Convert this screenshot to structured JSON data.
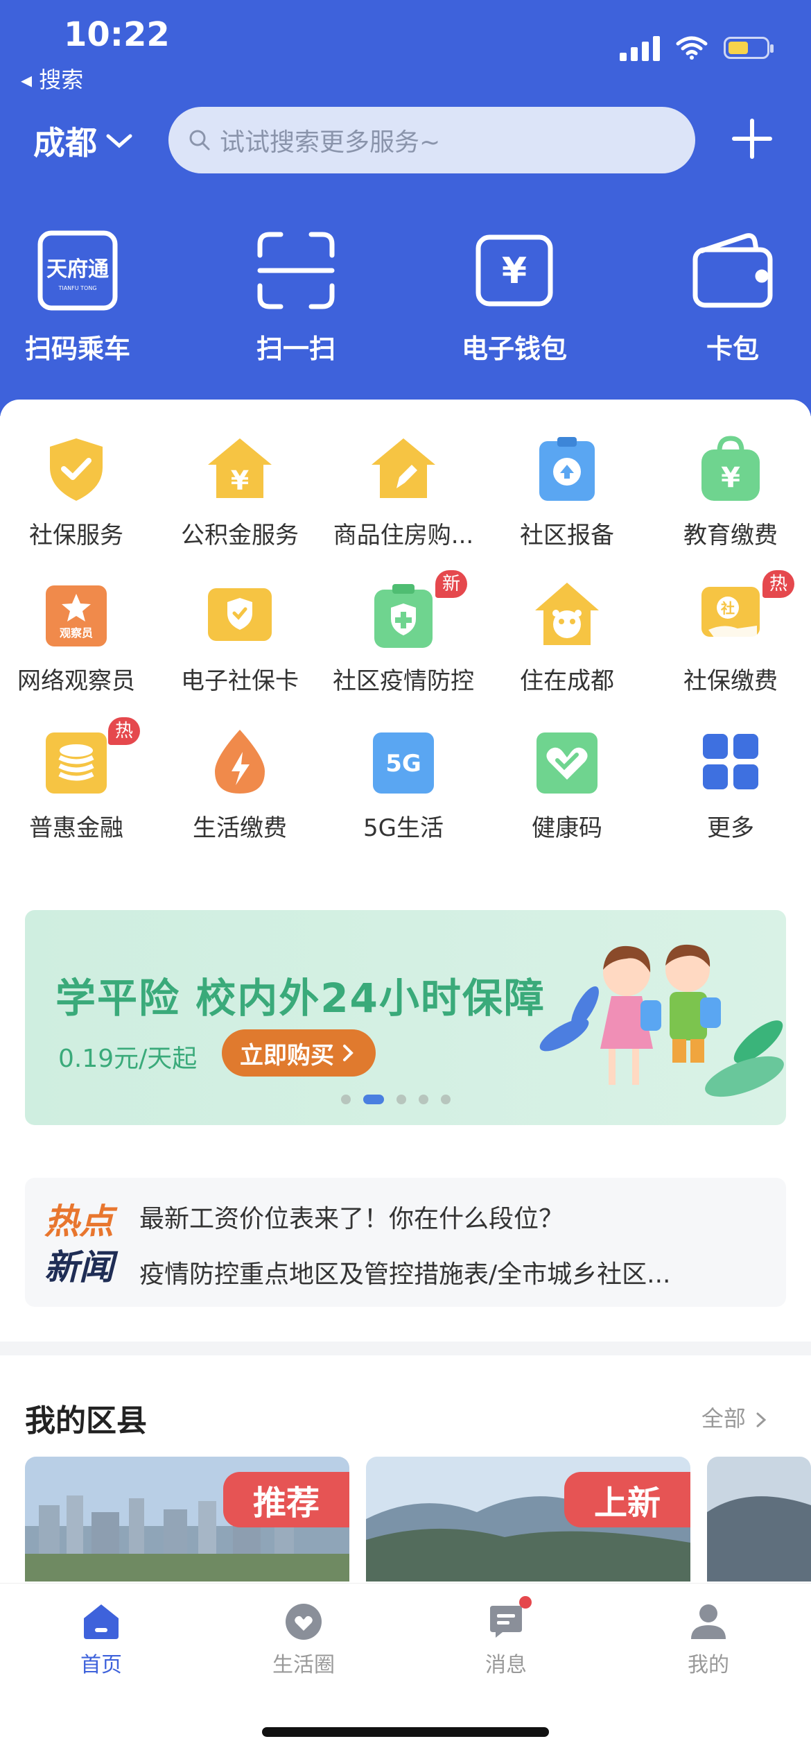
{
  "status_bar": {
    "time": "10:22",
    "back_label": "◂ 搜索"
  },
  "header": {
    "city": "成都",
    "search_placeholder": "试试搜索更多服务~"
  },
  "quick_actions": [
    {
      "label": "扫码乘车",
      "icon": "tianfutong-card-icon",
      "icon_text": "天府通",
      "icon_sub": "TIANFU TONG"
    },
    {
      "label": "扫一扫",
      "icon": "scan-icon"
    },
    {
      "label": "电子钱包",
      "icon": "yuan-wallet-icon",
      "icon_text": "¥"
    },
    {
      "label": "卡包",
      "icon": "card-wallet-icon"
    }
  ],
  "services": [
    {
      "label": "社保服务",
      "icon": "shield-check-icon"
    },
    {
      "label": "公积金服务",
      "icon": "house-yuan-icon",
      "icon_text": "¥"
    },
    {
      "label": "商品住房购...",
      "icon": "house-pen-icon"
    },
    {
      "label": "社区报备",
      "icon": "clipboard-upload-icon"
    },
    {
      "label": "教育缴费",
      "icon": "bag-yuan-icon",
      "icon_text": "¥"
    },
    {
      "label": "网络观察员",
      "icon": "observer-star-icon",
      "icon_text": "观察员"
    },
    {
      "label": "电子社保卡",
      "icon": "social-card-icon"
    },
    {
      "label": "社区疫情防控",
      "icon": "medical-kit-icon",
      "badge": "新"
    },
    {
      "label": "住在成都",
      "icon": "house-panda-icon"
    },
    {
      "label": "社保缴费",
      "icon": "hand-payment-icon",
      "icon_text": "社",
      "badge": "热"
    },
    {
      "label": "普惠金融",
      "icon": "coins-icon",
      "badge": "热"
    },
    {
      "label": "生活缴费",
      "icon": "lightning-drop-icon"
    },
    {
      "label": "5G生活",
      "icon": "5g-icon",
      "icon_text": "5G"
    },
    {
      "label": "健康码",
      "icon": "heart-check-icon"
    },
    {
      "label": "更多",
      "icon": "grid-more-icon"
    }
  ],
  "banner": {
    "title": "学平险 校内外24小时保障",
    "price": "0.19元/天起",
    "button": "立即购买",
    "dots": 5,
    "active_dot": 1
  },
  "news": {
    "tag_line1": "热点",
    "tag_line2": "新闻",
    "items": [
      "最新工资价位表来了！你在什么段位？",
      "疫情防控重点地区及管控措施表/全市城乡社区..."
    ]
  },
  "districts": {
    "title": "我的区县",
    "more": "全部",
    "cards": [
      {
        "badge": "推荐"
      },
      {
        "badge": "上新"
      },
      {
        "badge": ""
      }
    ]
  },
  "tabbar": [
    {
      "label": "首页",
      "icon": "home-icon",
      "active": true
    },
    {
      "label": "生活圈",
      "icon": "heart-location-icon",
      "active": false
    },
    {
      "label": "消息",
      "icon": "message-icon",
      "active": false
    },
    {
      "label": "我的",
      "icon": "person-icon",
      "active": false
    }
  ],
  "colors": {
    "brand": "#3e62db",
    "badge": "#e5484d",
    "banner_text": "#3aaa7a",
    "banner_button": "#e07a2e"
  }
}
